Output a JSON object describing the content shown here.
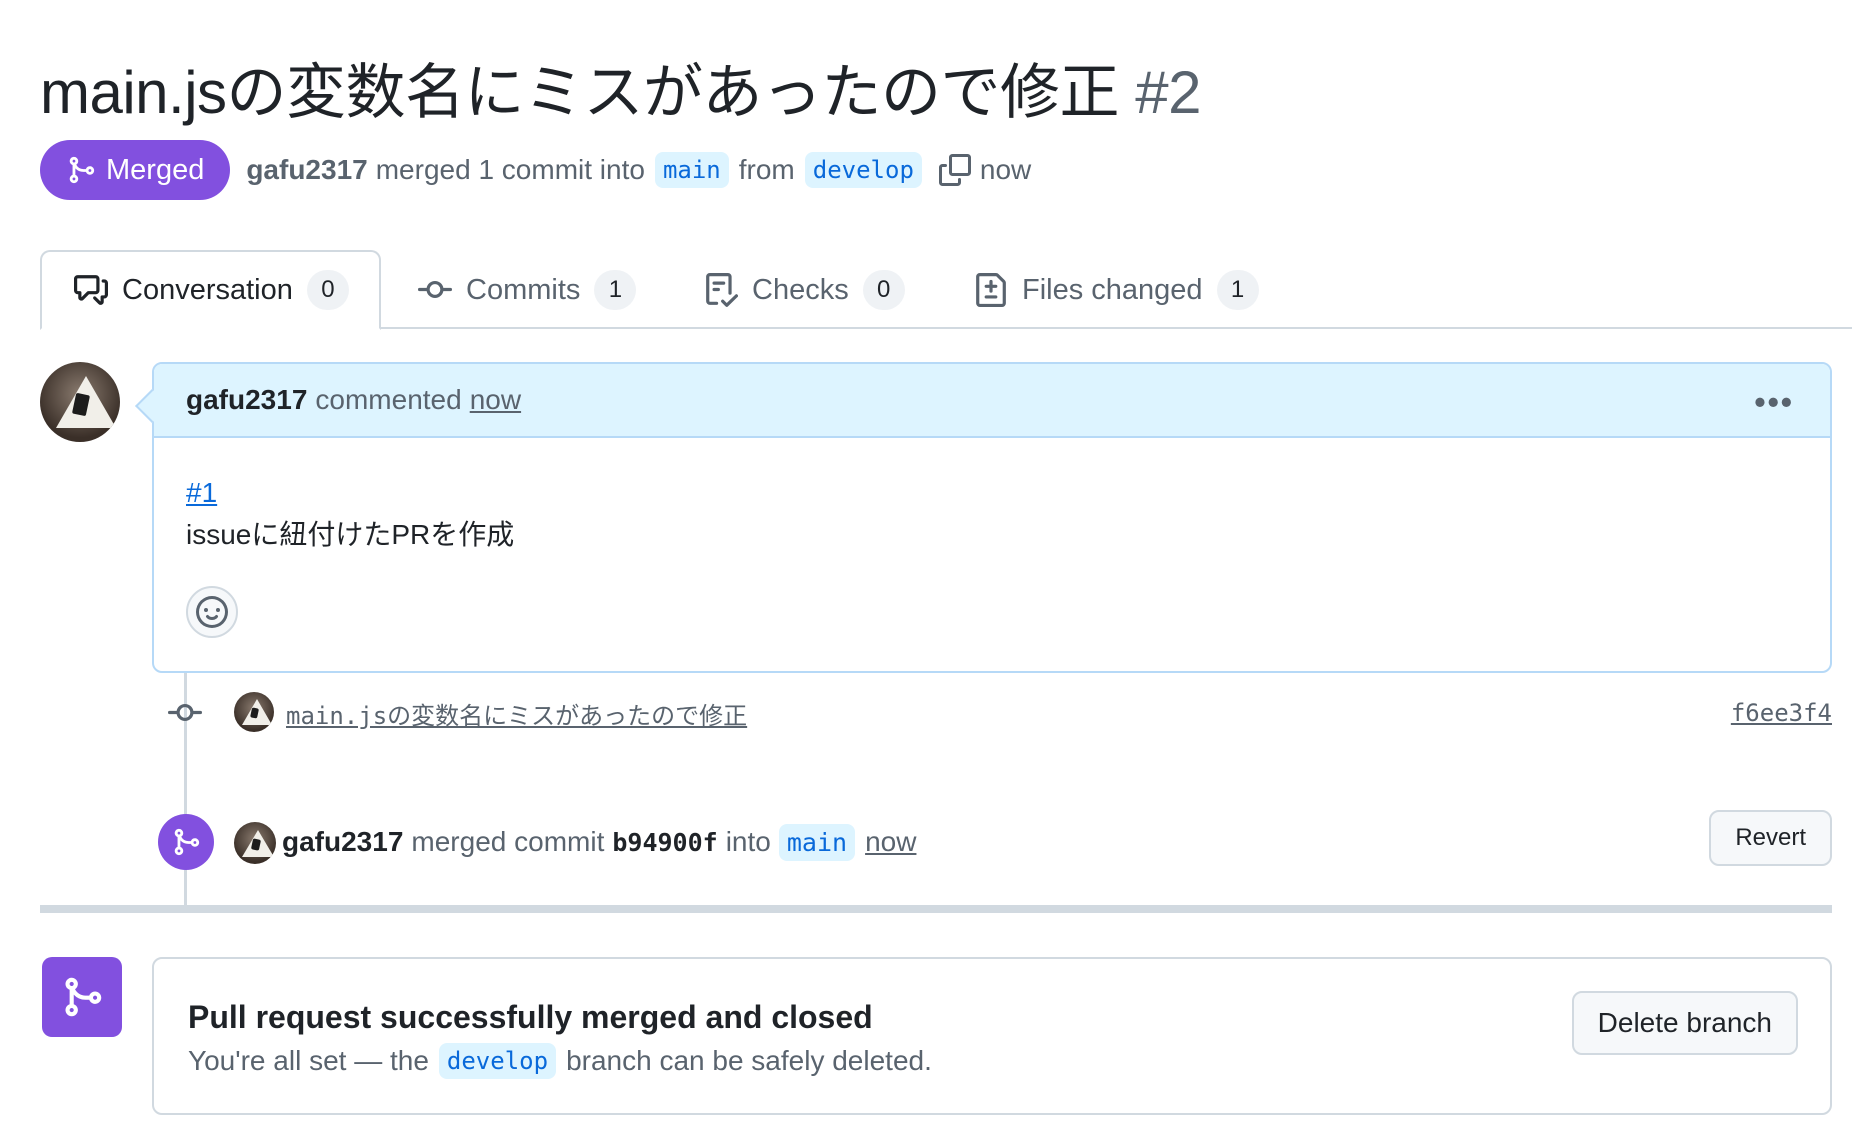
{
  "pr": {
    "title": "main.jsの変数名にミスがあったので修正",
    "number": "#2",
    "state_label": "Merged",
    "author": "gafu2317",
    "merge_text": "merged 1 commit into",
    "base_branch": "main",
    "from_text": "from",
    "head_branch": "develop",
    "time": "now"
  },
  "tabs": [
    {
      "label": "Conversation",
      "count": "0",
      "icon": "comment-discussion-icon"
    },
    {
      "label": "Commits",
      "count": "1",
      "icon": "git-commit-icon"
    },
    {
      "label": "Checks",
      "count": "0",
      "icon": "checklist-icon"
    },
    {
      "label": "Files changed",
      "count": "1",
      "icon": "file-diff-icon"
    }
  ],
  "comment": {
    "author": "gafu2317",
    "action": "commented",
    "time": "now",
    "issue_link": "#1",
    "body": "issueに紐付けたPRを作成",
    "menu": "•••"
  },
  "commit": {
    "message": "main.jsの変数名にミスがあったので修正",
    "sha": "f6ee3f4"
  },
  "merge_event": {
    "author": "gafu2317",
    "text": "merged commit",
    "sha": "b94900f",
    "into": "into",
    "branch": "main",
    "time": "now",
    "revert_label": "Revert"
  },
  "status": {
    "title": "Pull request successfully merged and closed",
    "sub_prefix": "You're all set — the",
    "branch": "develop",
    "sub_suffix": "branch can be safely deleted.",
    "delete_label": "Delete branch"
  },
  "colors": {
    "merged": "#8250df",
    "link": "#0969da",
    "branch_bg": "#ddf4ff",
    "border": "#d1d9e0"
  }
}
